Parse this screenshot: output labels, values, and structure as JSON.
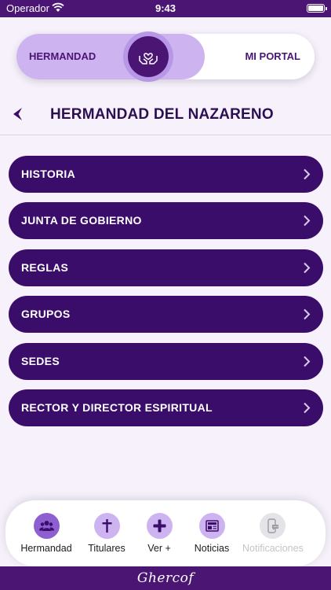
{
  "status_bar": {
    "carrier": "Operador",
    "time": "9:43"
  },
  "switch": {
    "left_label": "HERMANDAD",
    "right_label": "MI PORTAL",
    "knob_icon": "hands-heart-icon"
  },
  "header": {
    "title": "HERMANDAD DEL NAZARENO"
  },
  "menu": [
    {
      "label": "HISTORIA"
    },
    {
      "label": "JUNTA DE GOBIERNO"
    },
    {
      "label": "REGLAS"
    },
    {
      "label": "GRUPOS"
    },
    {
      "label": "SEDES"
    },
    {
      "label": "RECTOR Y DIRECTOR ESPIRITUAL"
    }
  ],
  "tabs": [
    {
      "label": "Hermandad",
      "icon": "people-icon"
    },
    {
      "label": "Titulares",
      "icon": "cross-icon"
    },
    {
      "label": "Ver +",
      "icon": "plus-icon"
    },
    {
      "label": "Noticias",
      "icon": "newspaper-icon"
    },
    {
      "label": "Notificaciones",
      "icon": "phone-chat-icon",
      "disabled": true
    }
  ],
  "brand": {
    "text": "Ghercof"
  },
  "colors": {
    "primary": "#4a1573",
    "menu_bg": "#3b0d6a",
    "accent_light": "#cdb3f0",
    "background": "#f6f1fb"
  }
}
